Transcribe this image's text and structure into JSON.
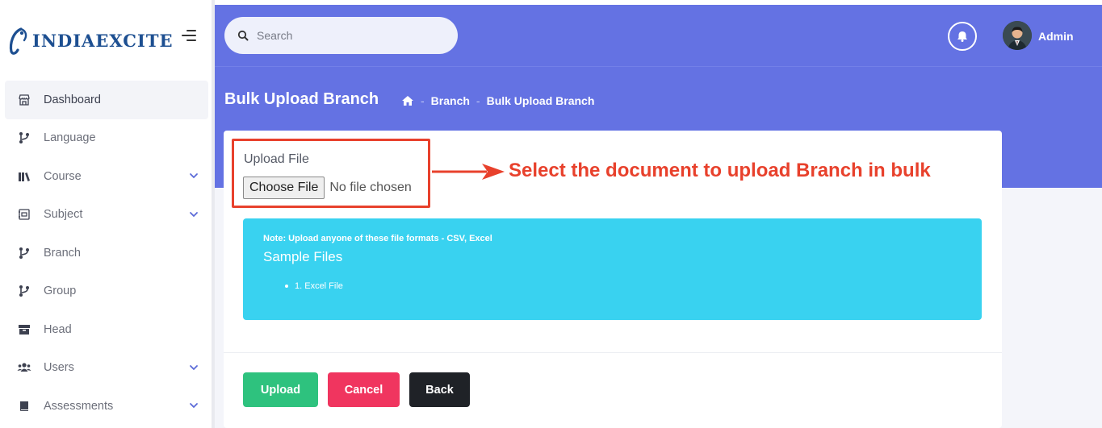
{
  "brand": {
    "name": "INDIAEXCITE"
  },
  "sidebar": {
    "items": [
      {
        "label": "Dashboard",
        "icon": "store-icon",
        "has_chevron": false,
        "active": true
      },
      {
        "label": "Language",
        "icon": "git-branch-icon",
        "has_chevron": false
      },
      {
        "label": "Course",
        "icon": "books-icon",
        "has_chevron": true
      },
      {
        "label": "Subject",
        "icon": "id-card-icon",
        "has_chevron": true
      },
      {
        "label": "Branch",
        "icon": "git-branch-icon",
        "has_chevron": false
      },
      {
        "label": "Group",
        "icon": "git-branch-icon",
        "has_chevron": false
      },
      {
        "label": "Head",
        "icon": "box-icon",
        "has_chevron": false
      },
      {
        "label": "Users",
        "icon": "users-icon",
        "has_chevron": true
      },
      {
        "label": "Assessments",
        "icon": "book-icon",
        "has_chevron": true
      }
    ]
  },
  "header": {
    "search_placeholder": "Search",
    "user_name": "Admin"
  },
  "page": {
    "title": "Bulk Upload Branch",
    "breadcrumb": [
      "Branch",
      "Bulk Upload Branch"
    ]
  },
  "form": {
    "upload_label": "Upload File",
    "choose_file_label": "Choose File",
    "no_file_text": "No file chosen"
  },
  "annotation": {
    "text": "Select the document to upload Branch in bulk",
    "color": "#e8412c"
  },
  "info": {
    "note": "Note: Upload anyone of these file formats - CSV, Excel",
    "sample_title": "Sample Files",
    "sample_item": "1. Excel File"
  },
  "buttons": {
    "upload": "Upload",
    "cancel": "Cancel",
    "back": "Back"
  },
  "colors": {
    "header": "#6472e3",
    "info": "#39d2f0",
    "upload": "#2ec27e",
    "cancel": "#f0355f",
    "back": "#1f2227"
  }
}
